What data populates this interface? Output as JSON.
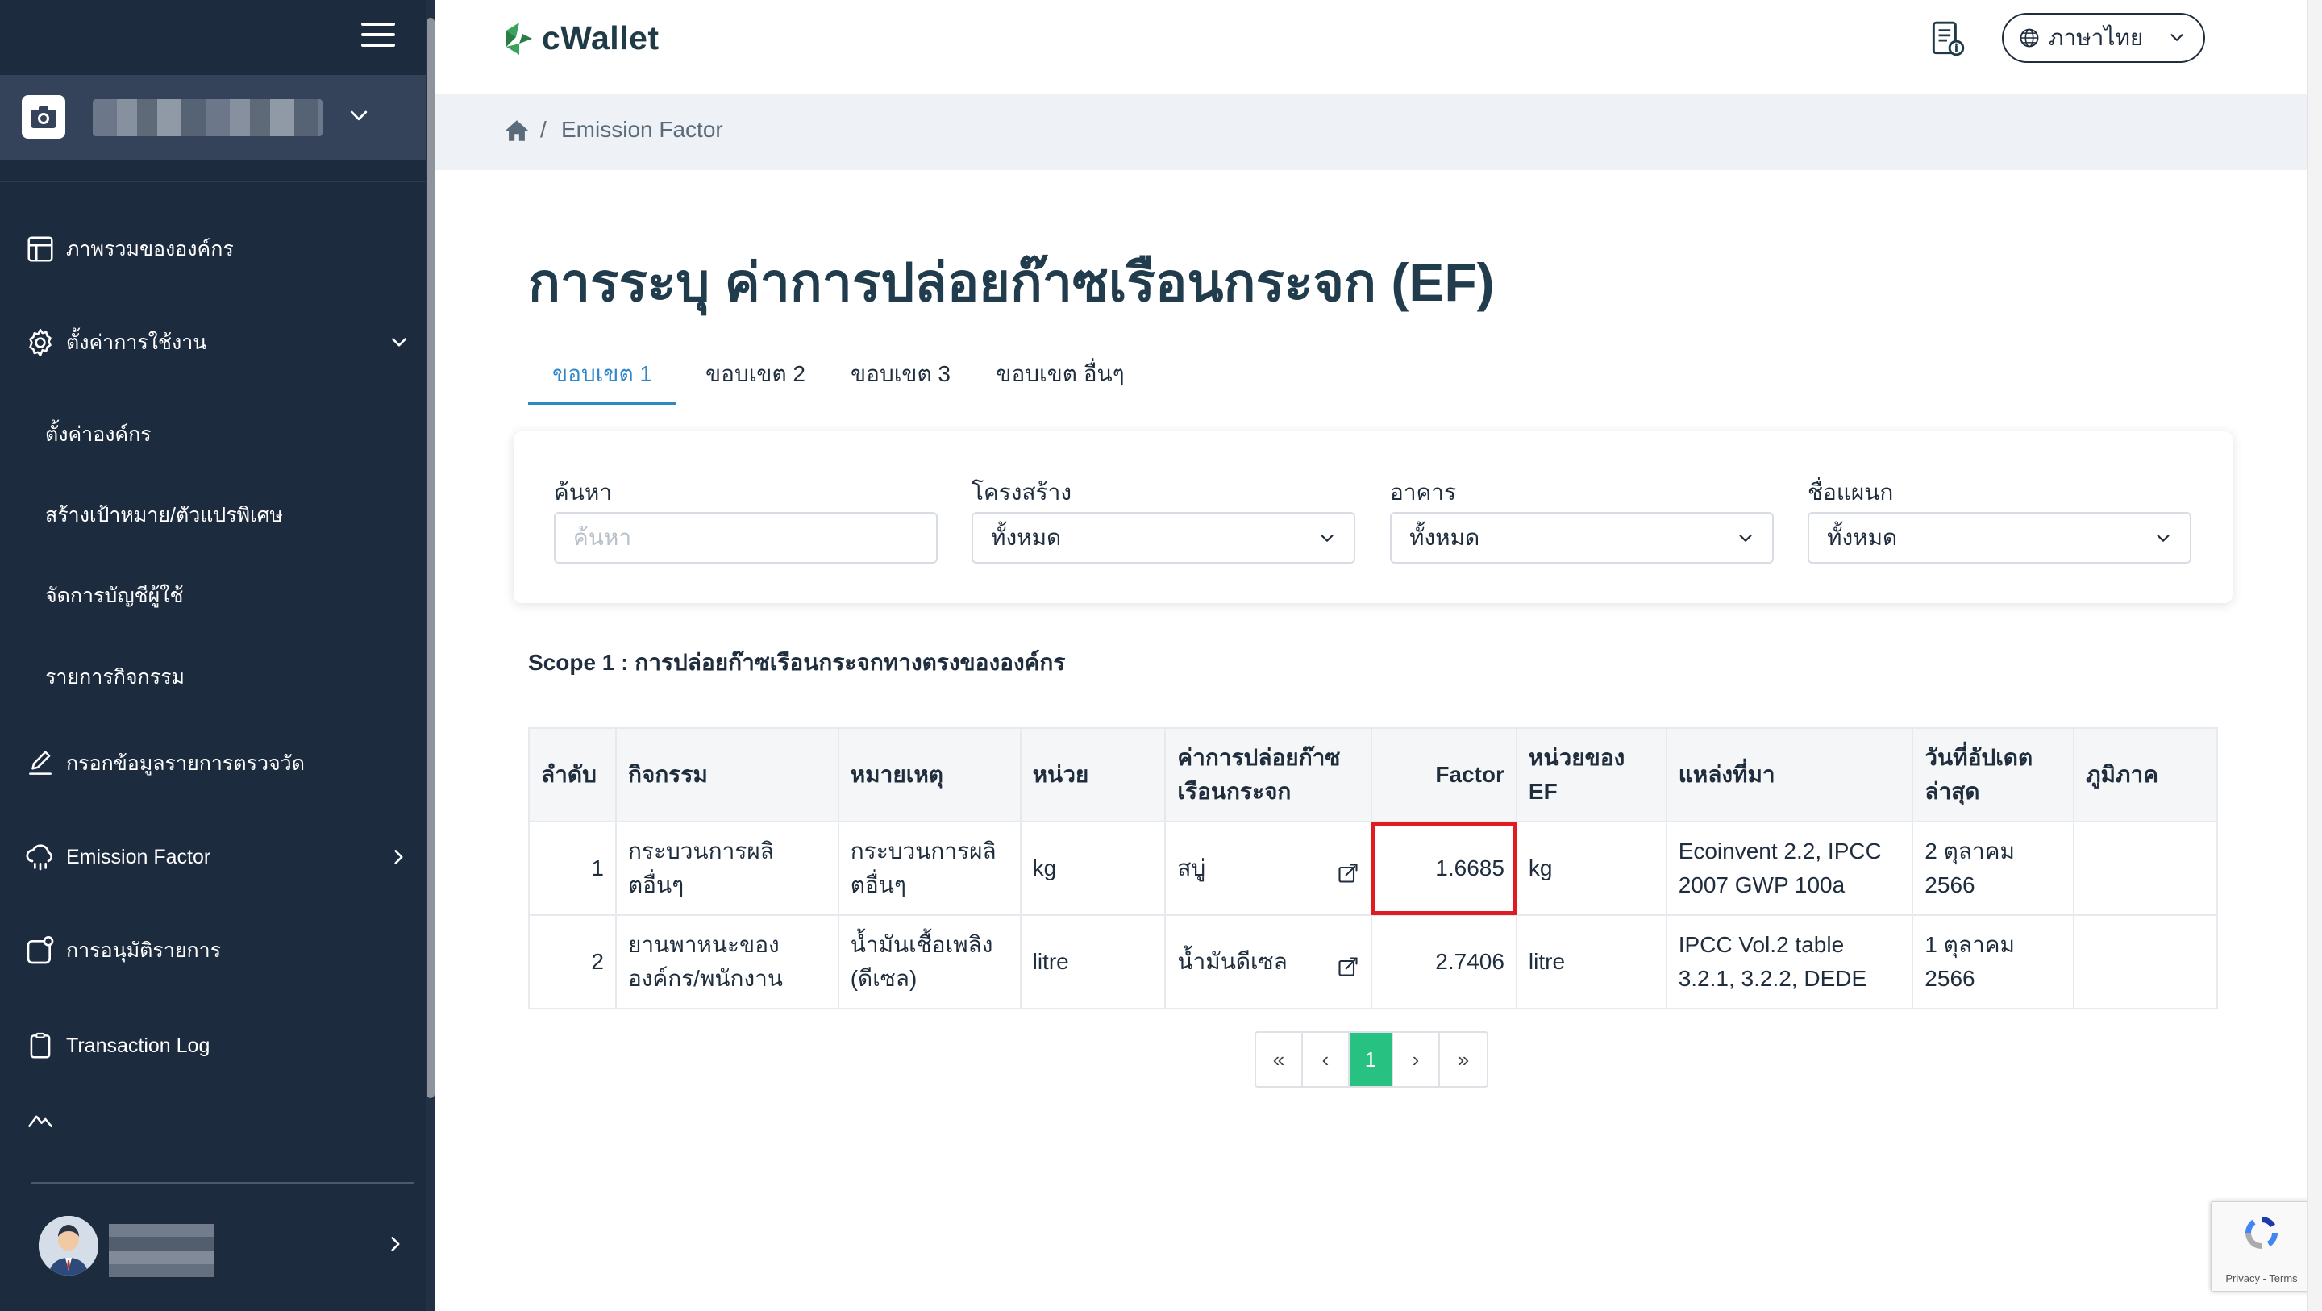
{
  "app": {
    "logo_text": "cWallet",
    "language": "ภาษาไทย"
  },
  "sidebar": {
    "items": [
      {
        "label": "ภาพรวมขององค์กร",
        "icon": "layout-icon"
      },
      {
        "label": "ตั้งค่าการใช้งาน",
        "icon": "gear-icon"
      },
      {
        "label": "กรอกข้อมูลรายการตรวจวัด",
        "icon": "pencil-icon"
      },
      {
        "label": "Emission Factor",
        "icon": "cloud-rain-icon"
      },
      {
        "label": "การอนุมัติรายการ",
        "icon": "approval-icon"
      },
      {
        "label": "Transaction Log",
        "icon": "clipboard-icon"
      }
    ],
    "sub_items": [
      "ตั้งค่าองค์กร",
      "สร้างเป้าหมาย/ตัวแปรพิเศษ",
      "จัดการบัญชีผู้ใช้",
      "รายการกิจกรรม"
    ]
  },
  "breadcrumb": {
    "separator": "/",
    "current": "Emission Factor"
  },
  "page": {
    "title": "การระบุ ค่าการปล่อยก๊าซเรือนกระจก (EF)"
  },
  "tabs": [
    "ขอบเขต 1",
    "ขอบเขต 2",
    "ขอบเขต 3",
    "ขอบเขต อื่นๆ"
  ],
  "filters": {
    "search_label": "ค้นหา",
    "search_placeholder": "ค้นหา",
    "structure_label": "โครงสร้าง",
    "structure_value": "ทั้งหมด",
    "building_label": "อาคาร",
    "building_value": "ทั้งหมด",
    "department_label": "ชื่อแผนก",
    "department_value": "ทั้งหมด"
  },
  "scope_title": "Scope 1 : การปล่อยก๊าซเรือนกระจกทางตรงขององค์กร",
  "table": {
    "headers": [
      "ลำดับ",
      "กิจกรรม",
      "หมายเหตุ",
      "หน่วย",
      "ค่าการปล่อยก๊าซเรือนกระจก",
      "Factor",
      "หน่วยของ EF",
      "แหล่งที่มา",
      "วันที่อัปเดตล่าสุด",
      "ภูมิภาค"
    ],
    "rows": [
      [
        "1",
        "กระบวนการผลิตอื่นๆ",
        "กระบวนการผลิตอื่นๆ",
        "kg",
        "สบู่",
        "1.6685",
        "kg",
        "Ecoinvent 2.2, IPCC 2007 GWP 100a",
        "2 ตุลาคม 2566",
        ""
      ],
      [
        "2",
        "ยานพาหนะขององค์กร/พนักงาน",
        "น้ำมันเชื้อเพลิง (ดีเซล)",
        "litre",
        "น้ำมันดีเซล",
        "2.7406",
        "litre",
        "IPCC Vol.2 table 3.2.1, 3.2.2, DEDE",
        "1 ตุลาคม 2566",
        ""
      ]
    ]
  },
  "pagination": {
    "first": "«",
    "prev": "‹",
    "current": "1",
    "next": "›",
    "last": "»"
  },
  "recaptcha": {
    "text": "Privacy - Terms"
  },
  "colors": {
    "sidebar_bg": "#1d2b3f",
    "accent": "#2f86c8",
    "page_active": "#27c281",
    "highlight": "#e11b22",
    "title": "#213c4c"
  }
}
